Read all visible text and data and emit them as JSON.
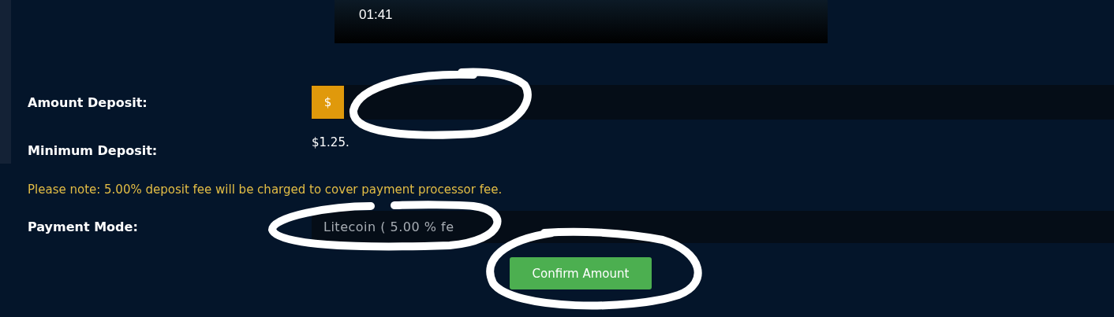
{
  "video": {
    "time": "01:41"
  },
  "amount": {
    "label": "Amount Deposit:",
    "currency": "$"
  },
  "minimum": {
    "label": "Minimum Deposit:",
    "value": "$1.25."
  },
  "note": "Please note: 5.00% deposit fee will be charged to cover payment processor fee.",
  "payment": {
    "label": "Payment Mode:",
    "value": "Litecoin ( 5.00 % fe"
  },
  "confirm_button": "Confirm Amount",
  "hand_marks": [
    {
      "kind": "ring"
    },
    {
      "kind": "ring"
    },
    {
      "kind": "ring"
    }
  ]
}
